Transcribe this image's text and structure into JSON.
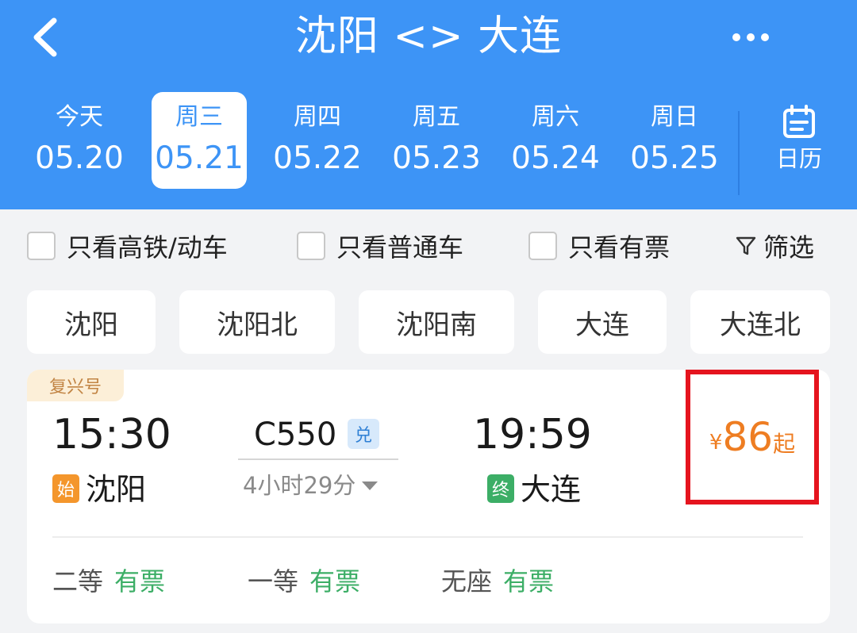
{
  "header": {
    "title": "沈阳 <> 大连",
    "back_icon": "chevron-left-icon",
    "more_icon": "more-horizontal-icon"
  },
  "dates": [
    {
      "weekday": "今天",
      "date": "05.20",
      "active": false
    },
    {
      "weekday": "周三",
      "date": "05.21",
      "active": true
    },
    {
      "weekday": "周四",
      "date": "05.22",
      "active": false
    },
    {
      "weekday": "周五",
      "date": "05.23",
      "active": false
    },
    {
      "weekday": "周六",
      "date": "05.24",
      "active": false
    },
    {
      "weekday": "周日",
      "date": "05.25",
      "active": false
    }
  ],
  "calendar": {
    "label": "日历",
    "icon": "calendar-icon"
  },
  "filters": {
    "high_speed": "只看高铁/动车",
    "normal": "只看普通车",
    "available": "只看有票",
    "filter_label": "筛选",
    "filter_icon": "funnel-icon"
  },
  "stations": [
    "沈阳",
    "沈阳北",
    "沈阳南",
    "大连",
    "大连北"
  ],
  "train": {
    "badge": "复兴号",
    "depart_time": "15:30",
    "depart_tag": "始",
    "depart_station": "沈阳",
    "train_number": "C550",
    "exchange_tag": "兑",
    "duration": "4小时29分",
    "arrive_time": "19:59",
    "arrive_tag": "终",
    "arrive_station": "大连",
    "price_currency": "¥",
    "price_amount": "86",
    "price_suffix": "起",
    "seats": [
      {
        "class": "二等",
        "status": "有票"
      },
      {
        "class": "一等",
        "status": "有票"
      },
      {
        "class": "无座",
        "status": "有票"
      }
    ]
  },
  "colors": {
    "header_bg": "#3d94f6",
    "price": "#ee7d22",
    "highlight_box": "#e5141e",
    "available": "#3cae66",
    "origin_tag": "#f4962c",
    "terminal_tag": "#3cae66"
  }
}
